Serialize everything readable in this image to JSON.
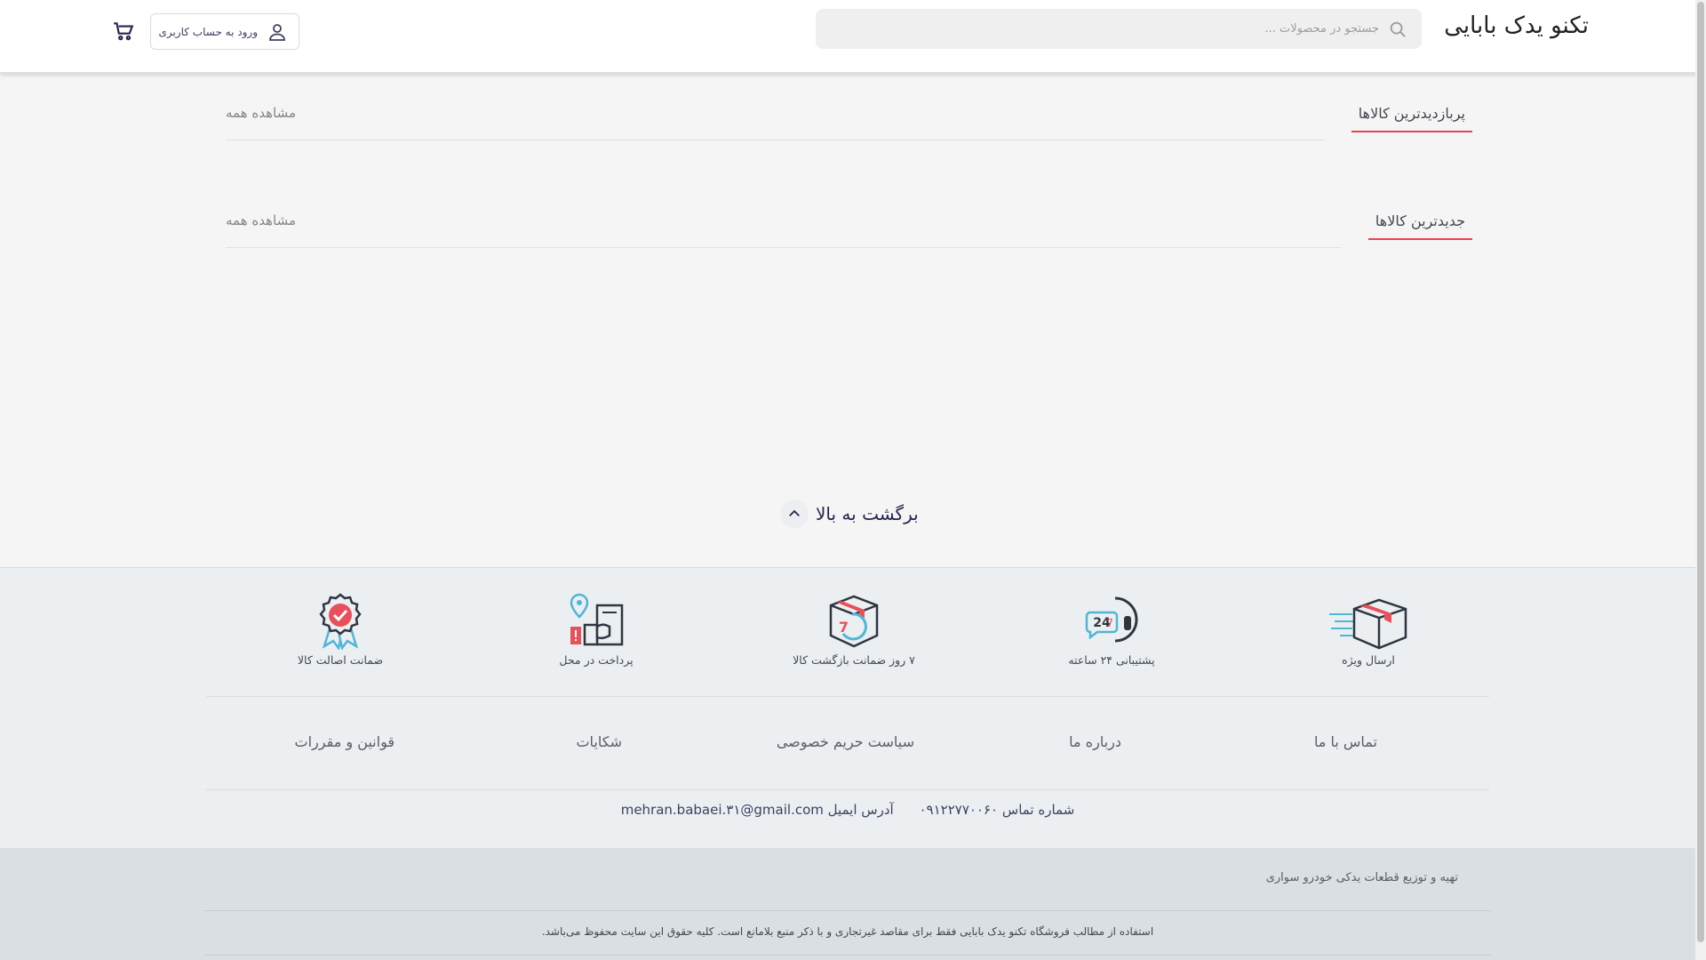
{
  "header": {
    "brand": "تکنو یدک بابایی",
    "search_placeholder": "جستجو در محصولات ...",
    "login_label": "ورود به حساب کاربری"
  },
  "sections": [
    {
      "title": "پربازدیدترین کالاها",
      "see_all": "مشاهده همه"
    },
    {
      "title": "جدیدترین کالاها",
      "see_all": "مشاهده همه"
    }
  ],
  "back_to_top": "برگشت به بالا",
  "features": [
    {
      "label": "ارسال ویژه",
      "icon": "fast-delivery-icon"
    },
    {
      "label": "پشتیبانی ۲۴ ساعته",
      "icon": "support-24-icon"
    },
    {
      "label": "۷ روز ضمانت بازگشت کالا",
      "icon": "return-guarantee-icon"
    },
    {
      "label": "پرداخت در محل",
      "icon": "cash-on-delivery-icon"
    },
    {
      "label": "ضمانت اصالت کالا",
      "icon": "authenticity-badge-icon"
    }
  ],
  "footer_links": [
    "تماس با ما",
    "درباره ما",
    "سیاست حریم خصوصی",
    "شکایات",
    "قوانین و مقررات"
  ],
  "contact": {
    "phone": "شماره تماس ۰۹۱۲۲۷۷۰۰۶۰",
    "email": "آدرس ایمیل mehran.babaei.۳۱@gmail.com"
  },
  "bottom": {
    "tagline": "تهیه و توزیع قطعات یدکی خودرو سواری",
    "copyright": "استفاده از مطالب فروشگاه تکنو یدک بابایی فقط برای مقاصد غیرتجاری و با ذکر منبع بلامانع است. کلیه حقوق این سایت محفوظ می‌باشد."
  },
  "colors": {
    "accent": "#ef4056",
    "brand_text": "#202124",
    "footer_bg": "#eceff1",
    "bottom_bg": "#dadfe3"
  }
}
